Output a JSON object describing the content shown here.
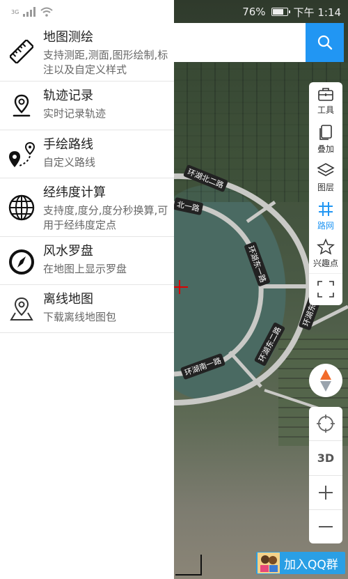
{
  "status_bar": {
    "network": "3G",
    "battery_percent": "76%",
    "battery_level": 0.76,
    "time": "下午 1:14"
  },
  "search": {
    "value": "",
    "placeholder": ""
  },
  "drawer": {
    "items": [
      {
        "icon": "ruler-icon",
        "title": "地图测绘",
        "desc": "支持测距,测面,图形绘制,标注以及自定义样式"
      },
      {
        "icon": "map-pin-icon",
        "title": "轨迹记录",
        "desc": "实时记录轨迹"
      },
      {
        "icon": "route-icon",
        "title": "手绘路线",
        "desc": "自定义路线"
      },
      {
        "icon": "globe-icon",
        "title": "经纬度计算",
        "desc": "支持度,度分,度分秒换算,可用于经纬度定点"
      },
      {
        "icon": "compass-icon",
        "title": "风水罗盘",
        "desc": "在地图上显示罗盘"
      },
      {
        "icon": "offline-map-icon",
        "title": "离线地图",
        "desc": "下载离线地图包"
      }
    ]
  },
  "toolbar": {
    "tools": "工具",
    "overlay": "叠加",
    "layers": "图层",
    "roads": "路网",
    "poi": "兴趣点"
  },
  "zoom_panel": {
    "mode_3d": "3D"
  },
  "qq_group": {
    "label": "加入QQ群"
  },
  "map": {
    "road_labels": {
      "north2": "环湖北二路",
      "north1": "北一路",
      "east1": "环湖东一路",
      "east2": "环湖东二路",
      "east3": "环湖东三",
      "south1": "环湖南一路"
    }
  },
  "colors": {
    "accent": "#2196f3",
    "qq": "#2a9fe5"
  }
}
